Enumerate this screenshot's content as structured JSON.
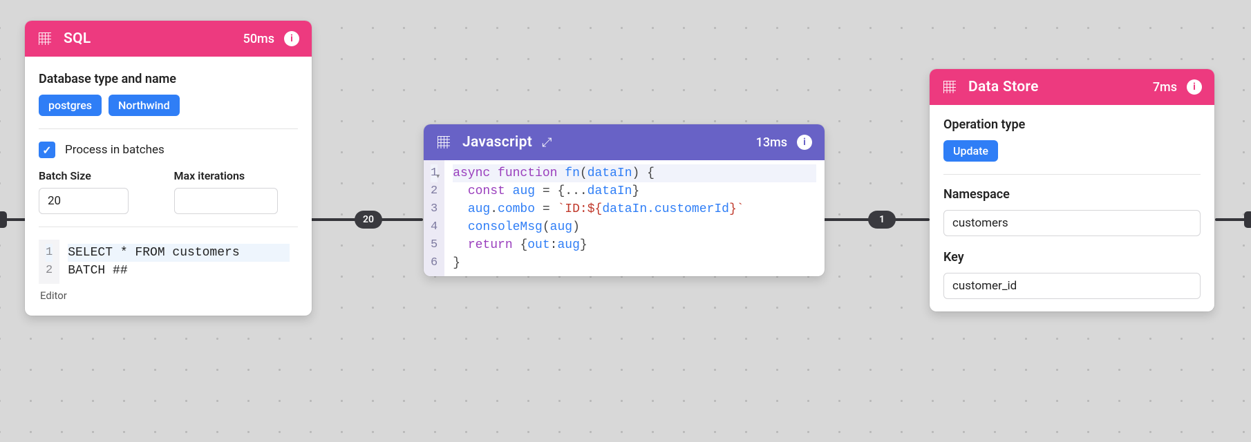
{
  "edges": {
    "pill1": "20",
    "pill2": "1"
  },
  "sql": {
    "title": "SQL",
    "time": "50ms",
    "section_label": "Database type and name",
    "chip_db": "postgres",
    "chip_name": "Northwind",
    "batches_label": "Process in batches",
    "batch_size_label": "Batch Size",
    "batch_size_value": "20",
    "max_iter_label": "Max iterations",
    "max_iter_value": "",
    "code": {
      "g1": "1",
      "g2": "2",
      "l1": "SELECT * FROM customers",
      "l2": "BATCH ##"
    },
    "editor_label": "Editor"
  },
  "js": {
    "title": "Javascript",
    "time": "13ms",
    "code": {
      "g1": "1",
      "g2": "2",
      "g3": "3",
      "g4": "4",
      "g5": "5",
      "g6": "6",
      "kw_async": "async",
      "kw_function": "function",
      "fn_name": "fn",
      "arg": "dataIn",
      "kw_const": "const",
      "var_aug": "aug",
      "prop_combo": "combo",
      "str_prefix": "`ID:",
      "str_interp_open": "${",
      "str_interp_path": "dataIn.customerId",
      "str_interp_close": "}`",
      "fn_consoleMsg": "consoleMsg",
      "kw_return": "return",
      "key_out": "out"
    }
  },
  "ds": {
    "title": "Data Store",
    "time": "7ms",
    "op_label": "Operation type",
    "op_chip": "Update",
    "ns_label": "Namespace",
    "ns_value": "customers",
    "key_label": "Key",
    "key_value": "customer_id"
  }
}
